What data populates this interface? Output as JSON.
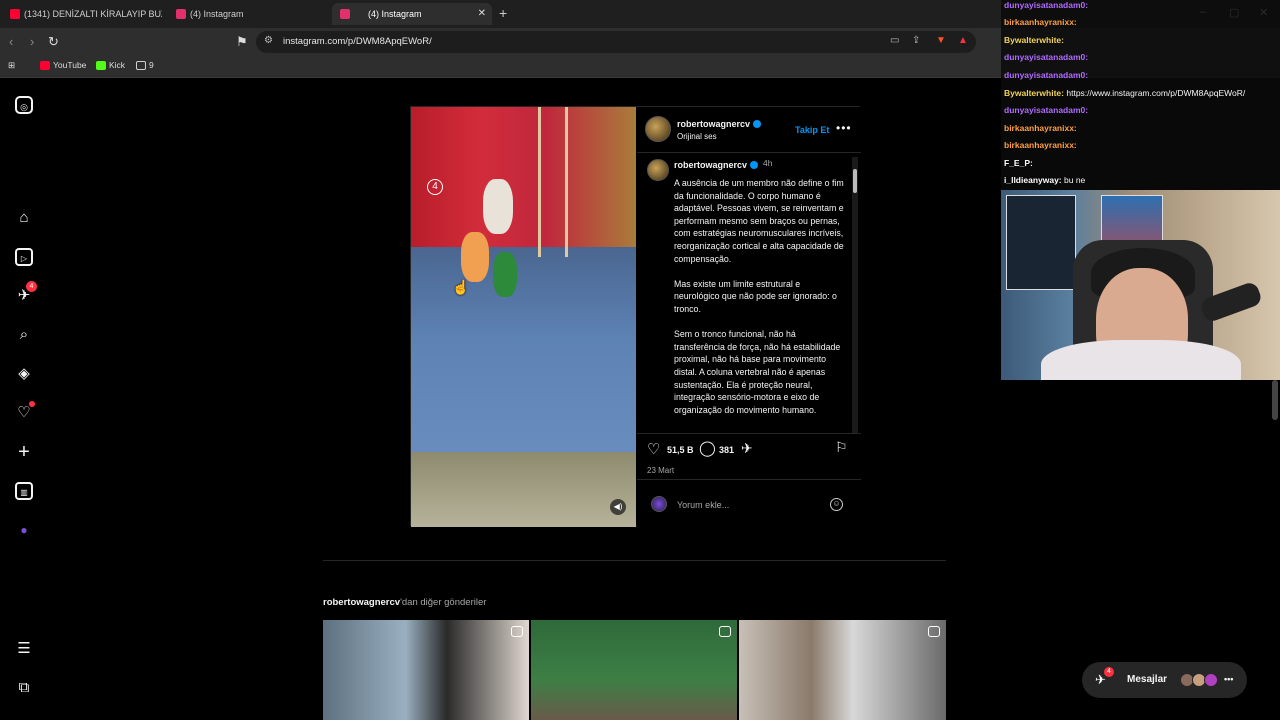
{
  "browser": {
    "tabs": [
      {
        "label": "(1341) DENİZALTI KİRALAYIP BUZUL...",
        "icon": "youtube-icon",
        "color": "#ff0033"
      },
      {
        "label": "(4) Instagram",
        "icon": "instagram-icon",
        "color": "#e1306c"
      },
      {
        "label": "(4) Instagram",
        "icon": "instagram-icon",
        "color": "#e1306c",
        "active": true
      }
    ],
    "new_tab": "+",
    "url": "instagram.com/p/DWM8ApqEWoR/",
    "bookmarks": [
      {
        "label": "YouTube",
        "icon": "youtube-icon",
        "color": "#ff0033"
      },
      {
        "label": "Kick",
        "icon": "kick-icon",
        "color": "#53fc18"
      },
      {
        "label": "9",
        "icon": "folder-icon",
        "color": "#cfcfcf"
      }
    ],
    "window_controls": [
      "–",
      "▢",
      "✕"
    ]
  },
  "sidebar": {
    "items": [
      {
        "name": "instagram-logo-icon",
        "glyph": "◎"
      },
      {
        "name": "home-icon",
        "glyph": "⌂"
      },
      {
        "name": "reels-icon",
        "glyph": "▷"
      },
      {
        "name": "direct-messages-icon",
        "glyph": "✈",
        "badge": "4"
      },
      {
        "name": "search-icon",
        "glyph": "⌕"
      },
      {
        "name": "explore-icon",
        "glyph": "◈"
      },
      {
        "name": "notifications-icon",
        "glyph": "♡",
        "dot": true
      },
      {
        "name": "create-icon",
        "glyph": "+"
      },
      {
        "name": "dashboard-icon",
        "glyph": "▥"
      },
      {
        "name": "profile-avatar-icon",
        "glyph": "●"
      },
      {
        "name": "more-menu-icon",
        "glyph": "☰"
      },
      {
        "name": "also-from-meta-icon",
        "glyph": "⧉"
      }
    ]
  },
  "post": {
    "username": "robertowagnercv",
    "audio": "Orijinal ses",
    "follow_label": "Takip Et",
    "more_label": "•••",
    "caption_username": "robertowagnercv",
    "caption_time": "4h",
    "caption": "A ausência de um membro não define o fim da funcionalidade. O corpo humano é adaptável. Pessoas vivem, se reinventam e performam mesmo sem braços ou pernas, com estratégias neuromusculares incríveis, reorganização cortical e alta capacidade de compensação.\n\nMas existe um limite estrutural e neurológico que não pode ser ignorado: o tronco.\n\nSem o tronco funcional, não há transferência de força, não há estabilidade proximal, não há base para movimento distal. A coluna vertebral não é apenas sustentação. Ela é proteção neural, integração sensório-motora e eixo de organização do movimento humano.",
    "video_marker": "4",
    "likes": "51,5 B",
    "comments": "381",
    "date": "23 Mart",
    "comment_placeholder": "Yorum ekle..."
  },
  "more_posts": {
    "username": "robertowagnercv",
    "suffix": "'dan diğer gönderiler"
  },
  "chat": {
    "lines": [
      {
        "user": "dunyayisatanadam0:",
        "color": "#b06bff",
        "msg": ""
      },
      {
        "user": "birkaanhayranixx:",
        "color": "#ff9f43",
        "msg": ""
      },
      {
        "user": "Bywalterwhite:",
        "color": "#f2d35b",
        "msg": ""
      },
      {
        "user": "dunyayisatanadam0:",
        "color": "#b06bff",
        "msg": ""
      },
      {
        "user": "dunyayisatanadam0:",
        "color": "#b06bff",
        "msg": ""
      },
      {
        "user": "Bywalterwhite:",
        "color": "#f2d35b",
        "msg": "https://www.instagram.com/p/DWM8ApqEWoR/"
      },
      {
        "user": "dunyayisatanadam0:",
        "color": "#b06bff",
        "msg": ""
      },
      {
        "user": "birkaanhayranixx:",
        "color": "#ff9f43",
        "msg": ""
      },
      {
        "user": "birkaanhayranixx:",
        "color": "#ff9f43",
        "msg": ""
      },
      {
        "user": "F_E_P:",
        "color": "#ffffff",
        "msg": ""
      },
      {
        "user": "i_lldieanyway:",
        "color": "#ffffff",
        "msg": "bu ne"
      }
    ]
  },
  "messages_button": {
    "label": "Mesajlar",
    "badge": "4"
  }
}
